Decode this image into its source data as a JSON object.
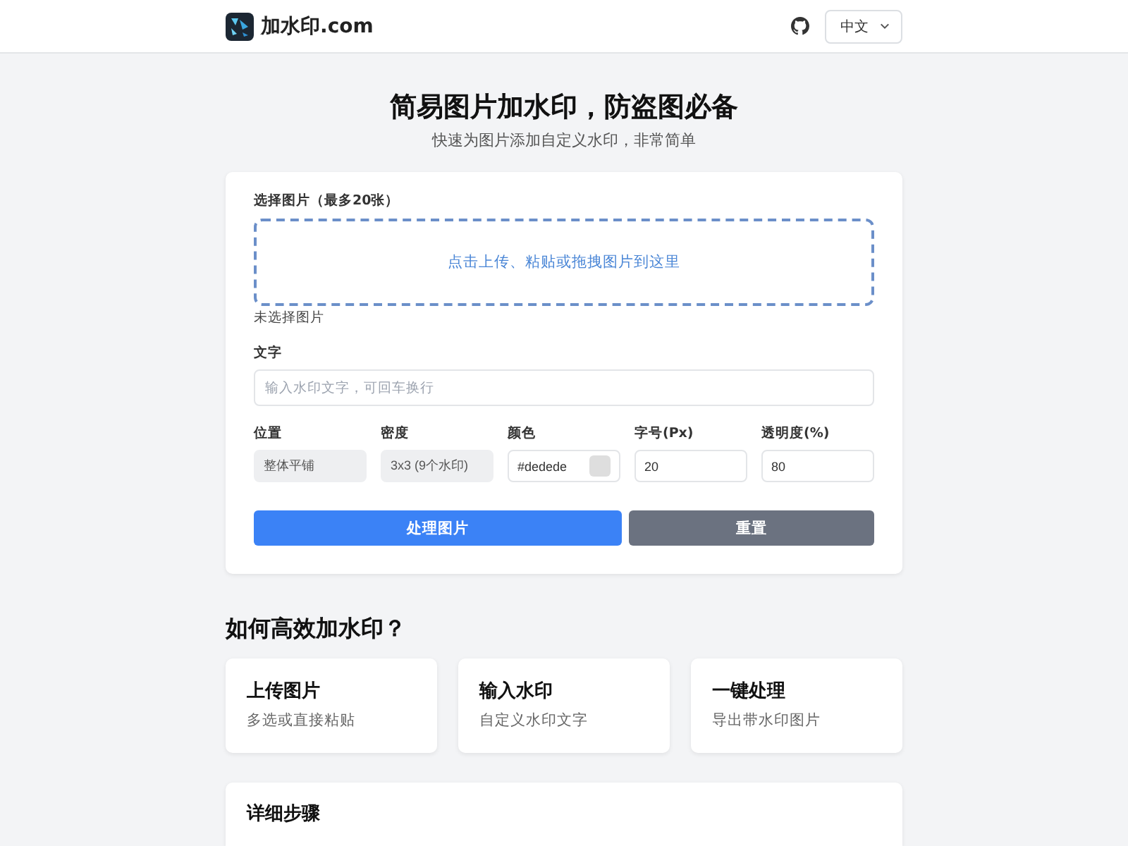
{
  "header": {
    "brand": "加水印.com",
    "language": "中文"
  },
  "hero": {
    "title": "简易图片加水印，防盗图必备",
    "subtitle": "快速为图片添加自定义水印，非常简单"
  },
  "form": {
    "upload": {
      "label": "选择图片（最多20张）",
      "prompt": "点击上传、粘贴或拖拽图片到这里",
      "status": "未选择图片"
    },
    "text": {
      "label": "文字",
      "placeholder": "输入水印文字，可回车换行"
    },
    "options": [
      {
        "label": "位置",
        "kind": "select",
        "value": "整体平铺",
        "disabled": true
      },
      {
        "label": "密度",
        "kind": "select",
        "value": "3x3 (9个水印)",
        "disabled": true
      },
      {
        "label": "颜色",
        "kind": "color",
        "value": "#dedede",
        "color": "#dedede",
        "disabled": false
      },
      {
        "label": "字号(Px)",
        "kind": "number",
        "value": "20",
        "disabled": false
      },
      {
        "label": "透明度(%)",
        "kind": "number",
        "value": "80",
        "disabled": false
      }
    ],
    "buttons": [
      {
        "label": "处理图片",
        "kind": "primary"
      },
      {
        "label": "重置",
        "kind": "secondary"
      }
    ]
  },
  "how_to": {
    "title": "如何高效加水印？",
    "steps": [
      {
        "title": "上传图片",
        "text": "多选或直接粘贴"
      },
      {
        "title": "输入水印",
        "text": "自定义水印文字"
      },
      {
        "title": "一键处理",
        "text": "导出带水印图片"
      }
    ]
  },
  "details": {
    "title": "详细步骤"
  }
}
